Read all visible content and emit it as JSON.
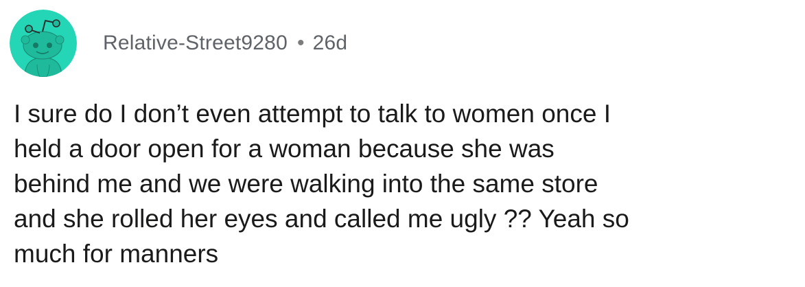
{
  "comment": {
    "author": "Relative-Street9280",
    "separator": "•",
    "age": "26d",
    "avatar_icon": "reddit-snoo-avatar-icon",
    "avatar_bg": "#24d6b5",
    "lines": [
      "I sure do I don’t even attempt to talk to women once I",
      "held a door open for a woman because she was",
      "behind me and we were walking into the same store",
      "and she rolled her eyes and called me ugly ?? Yeah so",
      "much for manners"
    ]
  }
}
